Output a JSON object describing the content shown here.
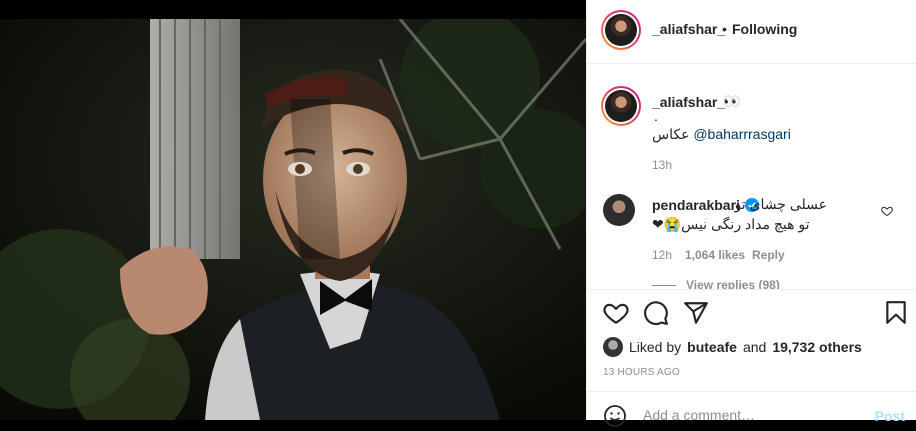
{
  "header": {
    "username": "_aliafshar_",
    "separator": "•",
    "follow_status": "Following"
  },
  "caption": {
    "username": "_aliafshar_",
    "emoji": "👀",
    "dot": ".",
    "text": "عکاس",
    "mention": "@baharrrasgari",
    "time": "13h"
  },
  "comment": {
    "username": "pendarakbari",
    "verified": true,
    "line1": "عسلی چشای تو ،",
    "line2": "تو هیچ مداد رنگی نیس",
    "line2_emoji": "❤😭",
    "time": "12h",
    "likes": "1,064 likes",
    "reply": "Reply"
  },
  "view_replies": "View replies (98)",
  "liked_by": {
    "prefix": "Liked by",
    "user": "buteafe",
    "middle": "and",
    "count": "19,732 others"
  },
  "timestamp": "13 HOURS AGO",
  "add_comment": {
    "placeholder": "Add a comment…",
    "post_label": "Post"
  },
  "icons": {
    "like": "heart-icon",
    "comment": "comment-icon",
    "share": "paper-plane-icon",
    "save": "bookmark-icon",
    "verified": "verified-badge-icon",
    "emoji": "smiley-icon"
  },
  "colors": {
    "text": "#262626",
    "muted": "#8e8e8e",
    "link": "#00376b",
    "verified": "#0095f6",
    "post_disabled": "#b2dffc",
    "heart_red": "#ed4956"
  }
}
